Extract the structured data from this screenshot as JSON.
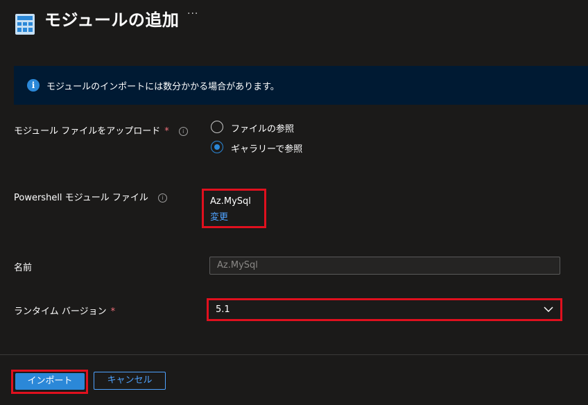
{
  "header": {
    "title": "モジュールの追加",
    "more_label": "···",
    "icon": "module-grid-icon"
  },
  "banner": {
    "icon": "info-icon",
    "text": "モジュールのインポートには数分かかる場合があります。"
  },
  "upload": {
    "label": "モジュール ファイルをアップロード",
    "required_mark": "*",
    "options": [
      {
        "label": "ファイルの参照",
        "selected": false
      },
      {
        "label": "ギャラリーで参照",
        "selected": true
      }
    ]
  },
  "module_file": {
    "label": "Powershell モジュール ファイル",
    "value": "Az.MySql",
    "change_label": "変更"
  },
  "name_field": {
    "label": "名前",
    "value": "Az.MySql"
  },
  "runtime": {
    "label": "ランタイム バージョン",
    "required_mark": "*",
    "value": "5.1"
  },
  "footer": {
    "import_label": "インポート",
    "cancel_label": "キャンセル"
  },
  "colors": {
    "accent": "#2b88d8",
    "highlight": "#e0101e",
    "banner_bg": "#001a33",
    "page_bg": "#1b1a19"
  }
}
